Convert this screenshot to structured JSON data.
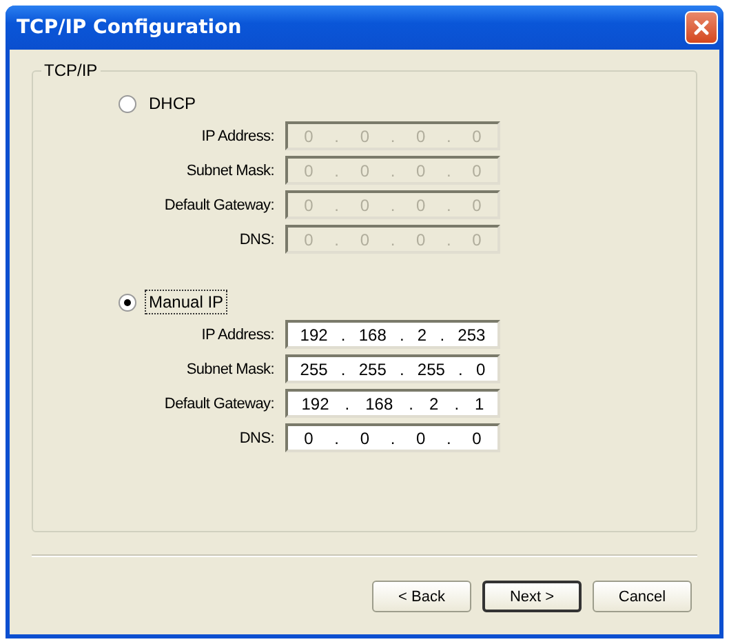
{
  "window": {
    "title": "TCP/IP Configuration"
  },
  "group": {
    "title": "TCP/IP"
  },
  "sections": [
    {
      "label": "DHCP",
      "selected": false,
      "focused": false,
      "fields": [
        {
          "label": "IP Address:",
          "value": "0 . 0 . 0 . 0",
          "disabled": true
        },
        {
          "label": "Subnet Mask:",
          "value": "0 . 0 . 0 . 0",
          "disabled": true
        },
        {
          "label": "Default Gateway:",
          "value": "0 . 0 . 0 . 0",
          "disabled": true
        },
        {
          "label": "DNS:",
          "value": "0 . 0 . 0 . 0",
          "disabled": true
        }
      ]
    },
    {
      "label": "Manual IP",
      "selected": true,
      "focused": true,
      "fields": [
        {
          "label": "IP Address:",
          "value": "192 . 168 . 2 . 253",
          "disabled": false
        },
        {
          "label": "Subnet Mask:",
          "value": "255 . 255 . 255 . 0",
          "disabled": false
        },
        {
          "label": "Default Gateway:",
          "value": "192 . 168 . 2 . 1",
          "disabled": false
        },
        {
          "label": "DNS:",
          "value": "0 . 0 . 0 . 0",
          "disabled": false
        }
      ]
    }
  ],
  "buttons": [
    {
      "label": "< Back",
      "default": false
    },
    {
      "label": "Next >",
      "default": true
    },
    {
      "label": "Cancel",
      "default": false
    }
  ]
}
